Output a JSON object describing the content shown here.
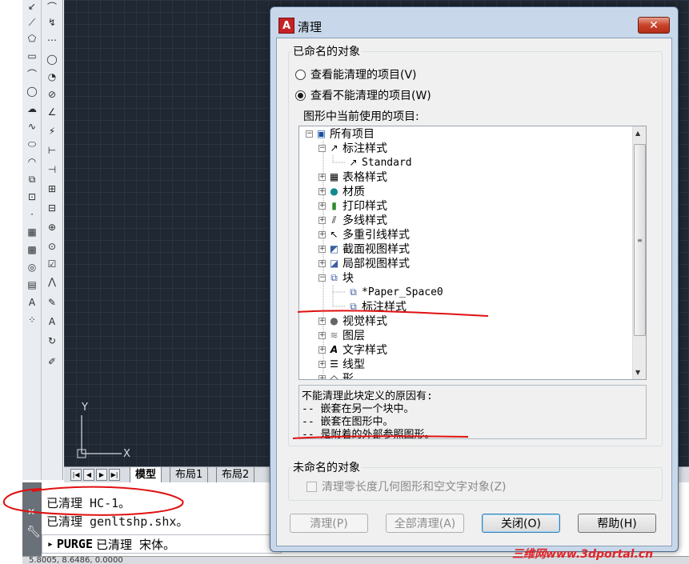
{
  "cad": {
    "layout_tabs": [
      "模型",
      "布局1",
      "布局2"
    ],
    "ucs": {
      "y": "Y",
      "x": "X"
    },
    "command_lines": [
      "已清理 HC-1。",
      "已清理 genltshp.shx。"
    ],
    "prompt": {
      "command": "PURGE",
      "text": "已清理 宋体。"
    },
    "status_coords": "5.8005, 8.6486, 0.0000",
    "watermark": "三维网www.3dportal.cn"
  },
  "dialog": {
    "title": "清理",
    "close_symbol": "✕",
    "named_group": "已命名的对象",
    "radio_purgeable": "查看能清理的项目(V)",
    "radio_nonpurgeable": "查看不能清理的项目(W)",
    "tree_label": "图形中当前使用的项目:",
    "tree": {
      "root": "所有项目",
      "dimstyle": "标注样式",
      "standard": "Standard",
      "tablestyle": "表格样式",
      "material": "材质",
      "plotstyle": "打印样式",
      "mlinestyle": "多线样式",
      "mleaderstyle": "多重引线样式",
      "sectionview": "截面视图样式",
      "detailview": "局部视图样式",
      "block": "块",
      "paperspace": "*Paper_Space0",
      "block_dimstyle": "标注样式",
      "visualstyle": "视觉样式",
      "layer": "图层",
      "textstyle": "文字样式",
      "linetype": "线型",
      "shape": "形"
    },
    "reasons": [
      "不能清理此块定义的原因有:",
      "-- 嵌套在另一个块中。",
      "-- 嵌套在图形中。",
      "-- 是附着的外部参照图形。"
    ],
    "unnamed_group": "未命名的对象",
    "checkbox_zero": "清理零长度几何图形和空文字对象(Z)",
    "buttons": {
      "purge": "清理(P)",
      "purge_all": "全部清理(A)",
      "close": "关闭(O)",
      "help": "帮助(H)"
    }
  },
  "colors": {
    "annotation": "#e01010",
    "canvas": "#202833",
    "dialog_frame": "#c8d8ea"
  }
}
